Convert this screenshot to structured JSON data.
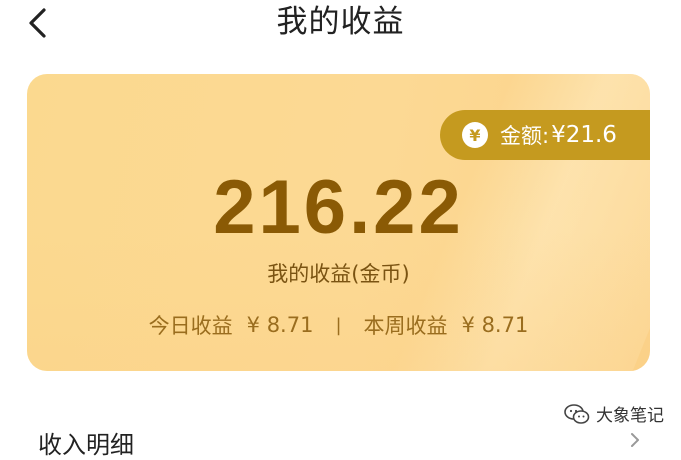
{
  "header": {
    "title": "我的收益"
  },
  "card": {
    "badge": {
      "currency_symbol": "¥",
      "label": "金额:",
      "value": "¥21.6"
    },
    "total_earnings": "216.22",
    "subtitle": "我的收益(金币)",
    "today": {
      "label": "今日收益",
      "value": "¥ 8.71"
    },
    "separator": "|",
    "week": {
      "label": "本周收益",
      "value": "¥ 8.71"
    }
  },
  "section": {
    "title": "收入明细"
  },
  "watermark": {
    "text": "大象笔记"
  },
  "colors": {
    "card_bg": "#fcd994",
    "badge_bg": "#c59a1f",
    "amount_text": "#8a5a05",
    "stat_text": "#9a6d1e"
  },
  "icons": {
    "back": "chevron-left-icon",
    "yen": "yen-coin-icon",
    "more": "chevron-right-icon",
    "wechat": "wechat-icon"
  }
}
